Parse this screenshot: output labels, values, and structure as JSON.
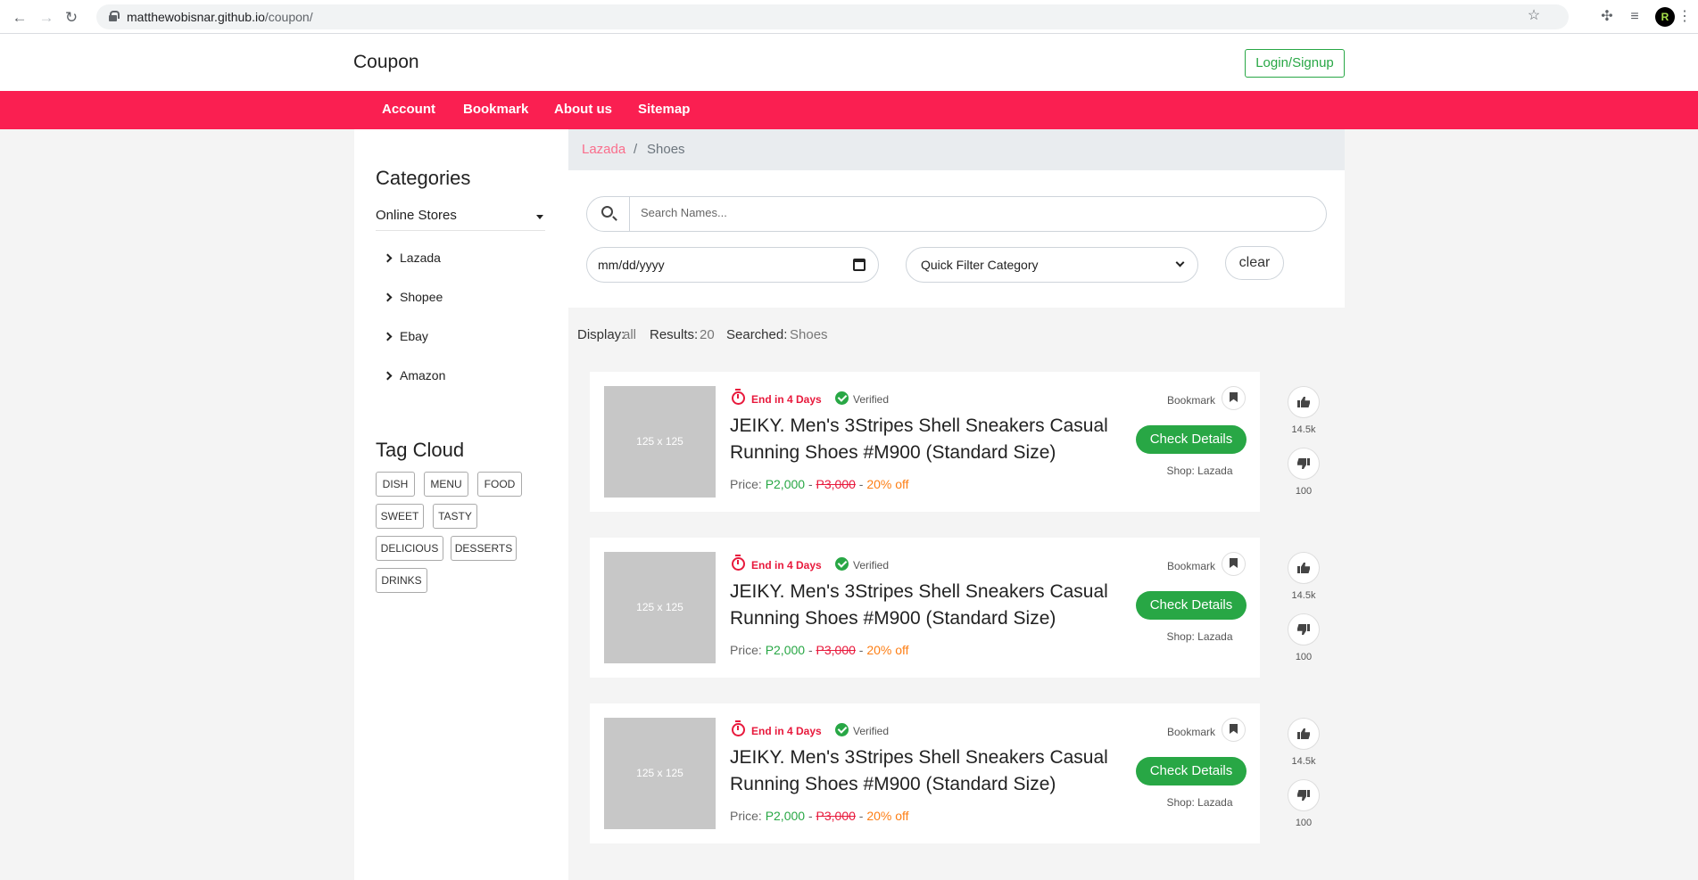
{
  "browser": {
    "url_host": "matthewobisnar.github.io",
    "url_path": "/coupon/",
    "profile_initial": "R"
  },
  "header": {
    "brand": "Coupon",
    "login_label": "Login/Signup"
  },
  "nav": {
    "items": [
      "Account",
      "Bookmark",
      "About us",
      "Sitemap"
    ]
  },
  "sidebar": {
    "categories_title": "Categories",
    "stores_toggle": "Online Stores",
    "stores": [
      "Lazada",
      "Shopee",
      "Ebay",
      "Amazon"
    ],
    "tag_cloud_title": "Tag Cloud",
    "tags": [
      "DISH",
      "MENU",
      "FOOD",
      "SWEET",
      "TASTY",
      "DELICIOUS",
      "DESSERTS",
      "DRINKS"
    ]
  },
  "breadcrumb": {
    "link": "Lazada",
    "separator": "/",
    "current": "Shoes"
  },
  "filters": {
    "search_placeholder": "Search Names...",
    "date_value": "mm/dd/yyyy",
    "category_value": "Quick Filter Category",
    "clear_label": "clear"
  },
  "results": {
    "display_label": "Display:",
    "display_value": "all",
    "results_label": "Results:",
    "results_value": "20",
    "searched_label": "Searched:",
    "searched_value": "Shoes"
  },
  "cards": [
    {
      "thumb": "125 x 125",
      "ends": "End in 4 Days",
      "verified": "Verified",
      "title": "JEIKY. Men's 3Stripes Shell Sneakers Casual Running Shoes #M900 (Standard Size)",
      "price_label": "Price:",
      "price_new": "P2,000",
      "price_old": "P3,000",
      "discount": "20% off",
      "bookmark_label": "Bookmark",
      "details_label": "Check Details",
      "shop": "Shop: Lazada",
      "likes": "14.5k",
      "dislikes": "100"
    },
    {
      "thumb": "125 x 125",
      "ends": "End in 4 Days",
      "verified": "Verified",
      "title": "JEIKY. Men's 3Stripes Shell Sneakers Casual Running Shoes #M900 (Standard Size)",
      "price_label": "Price:",
      "price_new": "P2,000",
      "price_old": "P3,000",
      "discount": "20% off",
      "bookmark_label": "Bookmark",
      "details_label": "Check Details",
      "shop": "Shop: Lazada",
      "likes": "14.5k",
      "dislikes": "100"
    },
    {
      "thumb": "125 x 125",
      "ends": "End in 4 Days",
      "verified": "Verified",
      "title": "JEIKY. Men's 3Stripes Shell Sneakers Casual Running Shoes #M900 (Standard Size)",
      "price_label": "Price:",
      "price_new": "P2,000",
      "price_old": "P3,000",
      "discount": "20% off",
      "bookmark_label": "Bookmark",
      "details_label": "Check Details",
      "shop": "Shop: Lazada",
      "likes": "14.5k",
      "dislikes": "100"
    }
  ],
  "colors": {
    "accent": "#fa1f51",
    "success": "#28a745",
    "danger": "#e8193c",
    "discount": "#fd7e14"
  }
}
